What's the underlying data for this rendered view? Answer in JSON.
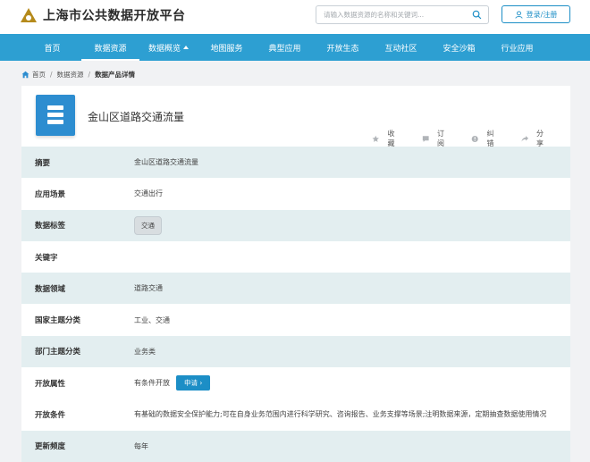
{
  "header": {
    "site_title": "上海市公共数据开放平台",
    "search_placeholder": "请输入数据资源的名称和关键词...",
    "login_label": "登录/注册"
  },
  "nav": {
    "items": [
      {
        "label": "首页"
      },
      {
        "label": "数据资源",
        "active": true
      },
      {
        "label": "数据概览"
      },
      {
        "label": "地图服务"
      },
      {
        "label": "典型应用"
      },
      {
        "label": "开放生态"
      },
      {
        "label": "互动社区"
      },
      {
        "label": "安全沙箱"
      },
      {
        "label": "行业应用"
      }
    ]
  },
  "breadcrumb": {
    "home": "首页",
    "level1": "数据资源",
    "current": "数据产品详情"
  },
  "dataset": {
    "title": "金山区道路交通流量",
    "actions": {
      "favorite": "收藏",
      "subscribe": "订阅",
      "correct": "纠错",
      "share": "分享"
    }
  },
  "details": {
    "summary": {
      "label": "摘要",
      "value": "金山区道路交通流量"
    },
    "scenario": {
      "label": "应用场景",
      "value": "交通出行"
    },
    "tags": {
      "label": "数据标签",
      "value": "交通"
    },
    "keywords": {
      "label": "关键字",
      "value": ""
    },
    "domain": {
      "label": "数据领域",
      "value": "道路交通"
    },
    "national_category": {
      "label": "国家主题分类",
      "value": "工业、交通"
    },
    "dept_category": {
      "label": "部门主题分类",
      "value": "业务类"
    },
    "open_attr": {
      "label": "开放属性",
      "value": "有条件开放",
      "apply_label": "申请 ›"
    },
    "open_condition": {
      "label": "开放条件",
      "value": "有基础的数据安全保护能力;可在自身业务范围内进行科学研究、咨询报告、业务支撑等场景;注明数据来源，定期抽查数据使用情况"
    },
    "update_freq": {
      "label": "更新频度",
      "value": "每年"
    }
  },
  "colors": {
    "nav_bg": "#2d9fd2",
    "accent": "#1c8ec6",
    "row_shade": "#e3eef0",
    "logo_gold": "#b58a1b"
  }
}
